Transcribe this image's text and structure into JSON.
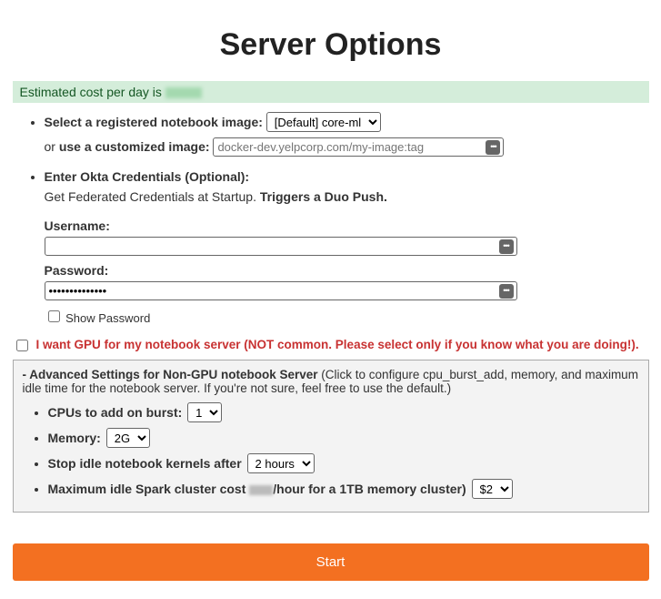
{
  "title": "Server Options",
  "estimate_label": "Estimated cost per day is ",
  "image": {
    "select_label": "Select a registered notebook image:",
    "selected": "[Default] core-ml",
    "or_text": "or ",
    "custom_label": "use a customized image:",
    "custom_placeholder": "docker-dev.yelpcorp.com/my-image:tag"
  },
  "okta": {
    "header": "Enter Okta Credentials (Optional):",
    "desc_pre": "Get Federated Credentials at Startup. ",
    "desc_bold": "Triggers a Duo Push.",
    "username_label": "Username:",
    "username_value": "",
    "password_label": "Password:",
    "password_value": "••••••••••••••",
    "show_pw_label": "Show Password"
  },
  "gpu_label": "I want GPU for my notebook server (NOT common. Please select only if you know what you are doing!).",
  "adv": {
    "header_lead": "- Advanced Settings for Non-GPU notebook Server",
    "header_rest": " (Click to configure cpu_burst_add, memory, and maximum idle time for the notebook server. If you're not sure, feel free to use the default.)",
    "cpu_label": "CPUs to add on burst:",
    "cpu_value": "1",
    "mem_label": "Memory:",
    "mem_value": "2G",
    "idle_label": "Stop idle notebook kernels after",
    "idle_value": "2 hours",
    "spark_pre": "Maximum idle Spark cluster cost ",
    "spark_post": "/hour for a 1TB memory cluster)",
    "spark_value": "$2"
  },
  "start_label": "Start"
}
